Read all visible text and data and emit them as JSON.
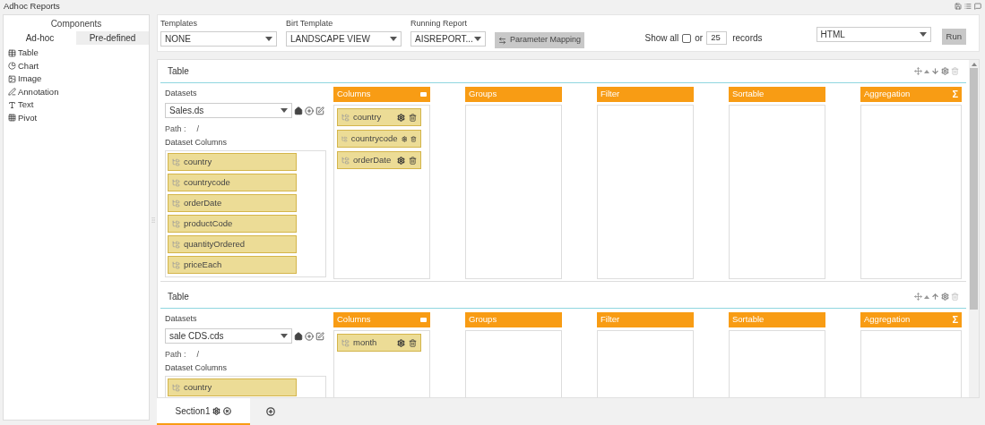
{
  "window": {
    "title": "Adhoc Reports"
  },
  "sidebar": {
    "title": "Components",
    "tabs": [
      {
        "label": "Ad-hoc",
        "selected": true
      },
      {
        "label": "Pre-defined",
        "selected": false
      }
    ],
    "items": [
      {
        "label": "Table",
        "kind": "table"
      },
      {
        "label": "Chart",
        "kind": "chart"
      },
      {
        "label": "Image",
        "kind": "image"
      },
      {
        "label": "Annotation",
        "kind": "annotation"
      },
      {
        "label": "Text",
        "kind": "text"
      },
      {
        "label": "Pivot",
        "kind": "pivot"
      }
    ]
  },
  "toolbar": {
    "templates": {
      "label": "Templates",
      "value": "NONE"
    },
    "birt_template": {
      "label": "Birt Template",
      "value": "LANDSCAPE VIEW"
    },
    "running_report": {
      "label": "Running Report",
      "value": "AISREPORT..."
    },
    "parameter_mapping": "Parameter Mapping",
    "show_all": {
      "label": "Show all",
      "checked": false
    },
    "or": "or",
    "record_count": "25",
    "records": "records",
    "format": "HTML",
    "run": "Run"
  },
  "tables": [
    {
      "title": "Table",
      "arrow_down": true,
      "datasets_label": "Datasets",
      "dataset": "Sales.ds",
      "path_label": "Path :",
      "path": "/",
      "dataset_columns_label": "Dataset Columns",
      "dataset_columns": [
        "country",
        "countrycode",
        "orderDate",
        "productCode",
        "quantityOrdered",
        "priceEach"
      ],
      "panels": [
        {
          "title": "Columns",
          "kind": "columns",
          "items": [
            "country",
            "countrycode",
            "orderDate"
          ]
        },
        {
          "title": "Groups",
          "kind": "plain"
        },
        {
          "title": "Filter",
          "kind": "plain"
        },
        {
          "title": "Sortable",
          "kind": "plain"
        },
        {
          "title": "Aggregation",
          "kind": "aggregation",
          "symbol": "Σ"
        }
      ]
    },
    {
      "title": "Table",
      "arrow_down": false,
      "datasets_label": "Datasets",
      "dataset": "sale CDS.cds",
      "path_label": "Path :",
      "path": "/",
      "dataset_columns_label": "Dataset Columns",
      "dataset_columns": [
        "country"
      ],
      "panels": [
        {
          "title": "Columns",
          "kind": "columns",
          "items": [
            "month"
          ]
        },
        {
          "title": "Groups",
          "kind": "plain"
        },
        {
          "title": "Filter",
          "kind": "plain"
        },
        {
          "title": "Sortable",
          "kind": "plain"
        },
        {
          "title": "Aggregation",
          "kind": "aggregation",
          "symbol": "Σ"
        }
      ]
    }
  ],
  "section_tabs": [
    {
      "label": "Section1",
      "selected": true
    }
  ]
}
